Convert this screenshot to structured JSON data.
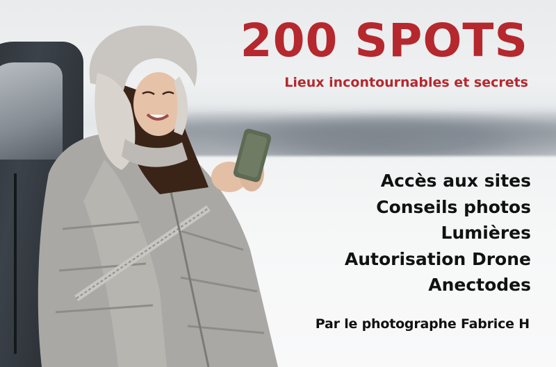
{
  "poster": {
    "title": "200 SPOTS",
    "subtitle": "Lieux incontournables et secrets",
    "features": [
      "Accès aux sites",
      "Conseils photos",
      "Lumières",
      "Autorisation Drone",
      "Anectodes"
    ],
    "author": "Par le photographe Fabrice H",
    "colors": {
      "title_red": "#b5282e",
      "text_dark": "#111111",
      "snow": "#f5f6f7"
    }
  }
}
